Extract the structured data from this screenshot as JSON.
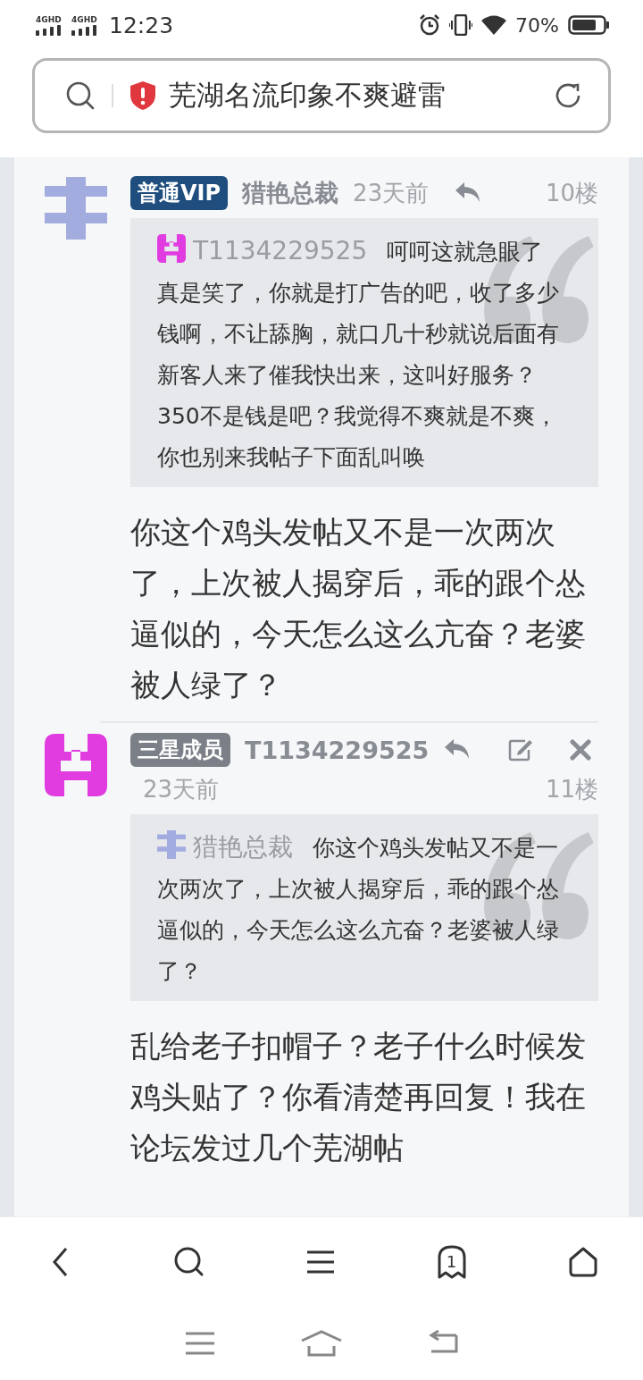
{
  "status_bar": {
    "networks": [
      "4GHD",
      "4GHD"
    ],
    "time": "12:23",
    "battery": "70%"
  },
  "address_bar": {
    "title": "芜湖名流印象不爽避雷"
  },
  "posts": [
    {
      "avatar": {
        "kind": "bars",
        "color": "#a3acdf"
      },
      "badge": {
        "label": "普通VIP",
        "color": "#1f4e7e"
      },
      "author": "猎艳总裁",
      "time": "23天前",
      "actions": [
        {
          "kind": "reply"
        }
      ],
      "floor": "10楼",
      "quote": {
        "avatar": {
          "kind": "cross",
          "color": "#e03ce0"
        },
        "author": "T1134229525",
        "text": "呵呵这就急眼了真是笑了，你就是打广告的吧，收了多少钱啊，不让舔胸，就口几十秒就说后面有新客人来了催我快出来，这叫好服务？350不是钱是吧？我觉得不爽就是不爽，你也别来我帖子下面乱叫唤"
      },
      "body": "你这个鸡头发帖又不是一次两次了，上次被人揭穿后，乖的跟个怂逼似的，今天怎么这么亢奋？老婆被人绿了？"
    },
    {
      "avatar": {
        "kind": "cross",
        "color": "#e03ce0"
      },
      "badge": {
        "label": "三星成员",
        "color": "#7b8088"
      },
      "author": "T1134229525",
      "time": "23天前",
      "actions": [
        {
          "kind": "reply"
        },
        {
          "kind": "edit"
        },
        {
          "kind": "delete"
        }
      ],
      "floor": "11楼",
      "quote": {
        "avatar": {
          "kind": "bars",
          "color": "#a3acdf"
        },
        "author": "猎艳总裁",
        "text": "你这个鸡头发帖又不是一次两次了，上次被人揭穿后，乖的跟个怂逼似的，今天怎么这么亢奋？老婆被人绿了？"
      },
      "body": "乱给老子扣帽子？老子什么时候发鸡头贴了？你看清楚再回复！我在论坛发过几个芜湖帖"
    }
  ],
  "toolbar": {
    "tab_count": "1"
  }
}
